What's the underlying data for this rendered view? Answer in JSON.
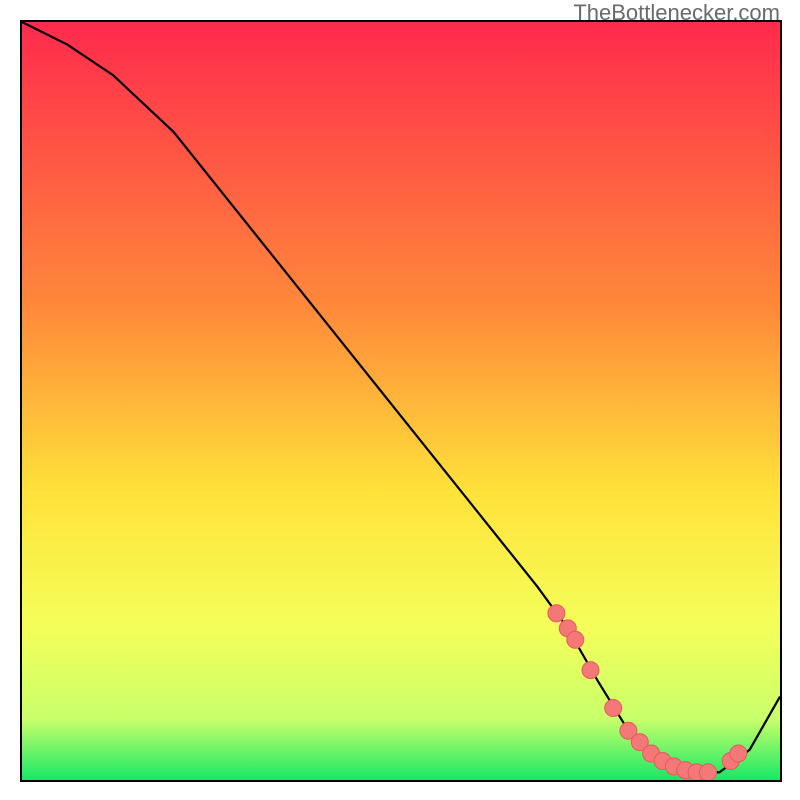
{
  "watermark": "TheBottlenecker.com",
  "colors": {
    "gradient_top": "#ff2a4d",
    "gradient_mid_upper": "#ff8a3a",
    "gradient_mid": "#ffe23a",
    "gradient_mid_lower": "#f4ff5a",
    "gradient_green_start": "#c8ff6a",
    "gradient_bottom": "#17e865",
    "curve": "#000000",
    "dot_fill": "#f37877",
    "dot_stroke": "#e85a59"
  },
  "chart_data": {
    "type": "line",
    "title": "",
    "xlabel": "",
    "ylabel": "",
    "xlim": [
      0,
      100
    ],
    "ylim": [
      0,
      100
    ],
    "curve": {
      "x": [
        0,
        6,
        12,
        20,
        30,
        40,
        50,
        60,
        68,
        72,
        76,
        80,
        84,
        88,
        92,
        96,
        100
      ],
      "y": [
        100,
        97,
        93,
        85.5,
        73,
        60.5,
        48,
        35.5,
        25.5,
        20,
        13,
        6.5,
        2.5,
        1,
        1,
        4,
        11
      ]
    },
    "series": [
      {
        "name": "markers",
        "x": [
          70.5,
          72,
          73,
          75,
          78,
          80,
          81.5,
          83,
          84.5,
          86,
          87.5,
          89,
          90.5,
          93.5,
          94.5
        ],
        "y": [
          22,
          20,
          18.5,
          14.5,
          9.5,
          6.5,
          5,
          3.5,
          2.5,
          1.8,
          1.3,
          1,
          1,
          2.5,
          3.5
        ]
      }
    ]
  }
}
